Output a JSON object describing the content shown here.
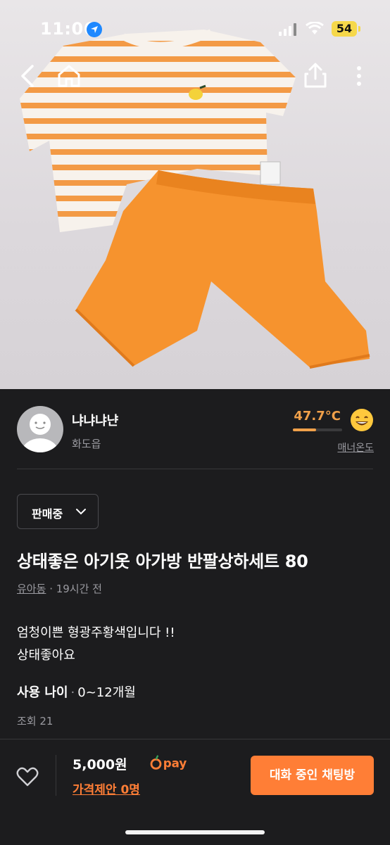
{
  "status_bar": {
    "time": "11:06",
    "battery": "54"
  },
  "nav": {
    "back_icon": "chevron-left-icon",
    "home_icon": "home-icon",
    "share_icon": "share-icon",
    "more_icon": "more-vertical-icon"
  },
  "photo": {
    "description_icon": "product-photo"
  },
  "seller": {
    "nickname": "냐냐냐냔",
    "region": "화도읍",
    "manner_temp": "47.7°C",
    "manner_temp_level": 0.477,
    "manner_label": "매너온도"
  },
  "sale_status": {
    "selected": "판매중"
  },
  "product": {
    "title": "상태좋은 아기옷 아가방 반팔상하세트 80",
    "category": "유아동",
    "time_ago": "· 19시간 전",
    "description_lines": [
      "엄청이쁜 형광주황색입니다 !!",
      "상태좋아요"
    ],
    "age_key": "사용 나이",
    "age_value": "0~12개월",
    "views": "조회 21"
  },
  "bottom_bar": {
    "price": "5,000원",
    "pay_label": "pay",
    "offer": "가격제안 0명",
    "chat_button": "대화 중인 채팅방"
  },
  "colors": {
    "accent": "#ff7e36",
    "temp": "#f0a04a",
    "background": "#1c1c1e"
  }
}
